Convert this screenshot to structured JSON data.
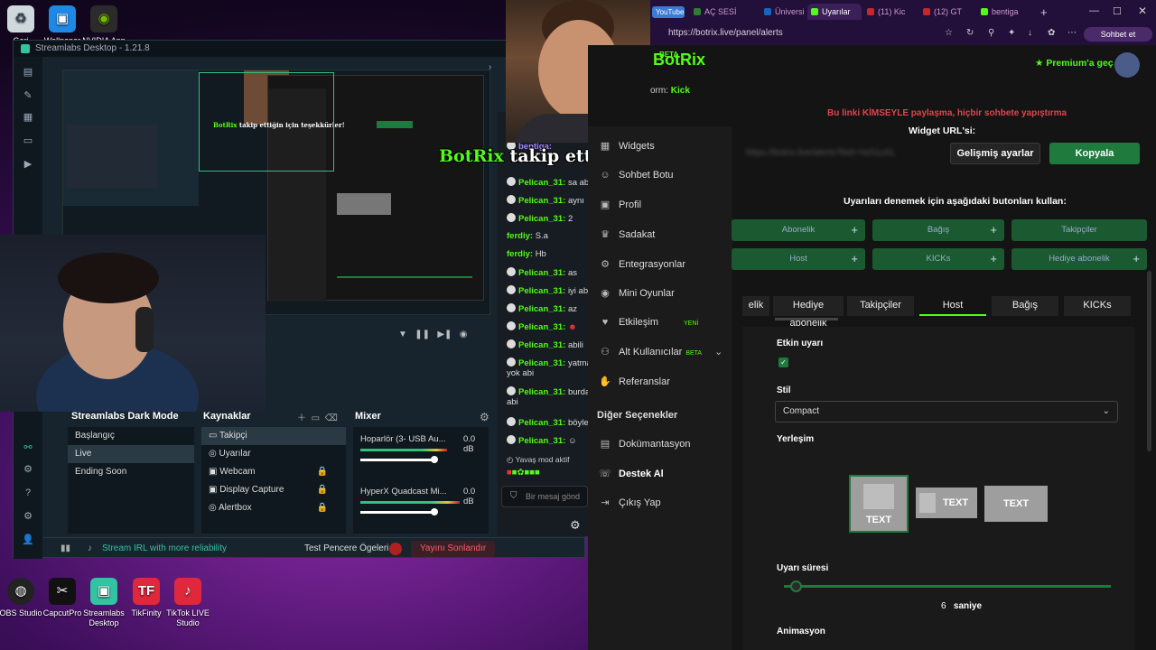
{
  "desktop": {
    "top_icons": [
      {
        "label": "Geri",
        "icon": "recycle-bin-icon"
      },
      {
        "label": "Wallpaper",
        "icon": "wallpaper-icon"
      },
      {
        "label": "NVIDIA App",
        "icon": "nvidia-icon"
      }
    ],
    "bottom_icons": [
      {
        "label": "OBS Studio",
        "icon": "obs-icon"
      },
      {
        "label": "CapcutPro",
        "icon": "capcut-icon"
      },
      {
        "label": "Streamlabs Desktop",
        "icon": "streamlabs-icon"
      },
      {
        "label": "TikFinity",
        "icon": "tikfinity-icon"
      },
      {
        "label": "TikTok LIVE Studio",
        "icon": "tiktok-live-icon"
      }
    ]
  },
  "streamlabs": {
    "title": "Streamlabs Desktop - 1.21.8",
    "scenes_title": "Streamlabs Dark Mode",
    "scenes": [
      "Başlangıç",
      "Live",
      "Ending Soon"
    ],
    "active_scene": "Live",
    "sources_title": "Kaynaklar",
    "sources": [
      "Takipçi",
      "Uyarılar",
      "Webcam",
      "Display Capture",
      "Alertbox"
    ],
    "mixer_title": "Mixer",
    "mixer": [
      {
        "name": "Hoparlör (3- USB Au...",
        "db": "0.0 dB"
      },
      {
        "name": "HyperX Quadcast Mi...",
        "db": "0.0 dB"
      }
    ],
    "footer": {
      "promo": "Stream IRL with more reliability",
      "test": "Test Pencere Ögeleri",
      "end_stream": "Yayını Sonlandır"
    }
  },
  "chat": {
    "messages": [
      {
        "user": "Pelican_31:",
        "text": "sa ab"
      },
      {
        "user": "Pelican_31:",
        "text": "aynı"
      },
      {
        "user": "Pelican_31:",
        "text": "2"
      },
      {
        "user": "ferdiy:",
        "text": "S.a"
      },
      {
        "user": "ferdiy:",
        "text": "Hb"
      },
      {
        "user": "Pelican_31:",
        "text": "as"
      },
      {
        "user": "Pelican_31:",
        "text": "iyi ab"
      },
      {
        "user": "Pelican_31:",
        "text": "az"
      },
      {
        "user": "Pelican_31:",
        "text": ""
      },
      {
        "user": "Pelican_31:",
        "text": "abili"
      },
      {
        "user": "Pelican_31:",
        "text": "yatma"
      },
      {
        "user": "",
        "text": "yok abi"
      },
      {
        "user": "Pelican_31:",
        "text": "burda"
      },
      {
        "user": "",
        "text": "abi"
      },
      {
        "user": "Pelican_31:",
        "text": "böyle"
      },
      {
        "user": "Pelican_31:",
        "text": ""
      }
    ],
    "first_user": "bentiga:",
    "slow_mode": "Yavaş mod aktif",
    "input_placeholder": "Bir mesaj gönd"
  },
  "overlay": {
    "brand": "BotRix",
    "text": " takip ettiğin için teşekkürler!"
  },
  "browser": {
    "tabs": [
      {
        "label": "YouTube",
        "color": "#d32f2f"
      },
      {
        "label": "AÇ SESİ",
        "color": "#2e7d32"
      },
      {
        "label": "Üniversi",
        "color": "#1565c0"
      },
      {
        "label": "Uyarılar",
        "color": "#53fc18"
      },
      {
        "label": "(11) Kic",
        "color": "#c62828"
      },
      {
        "label": "(12) GT",
        "color": "#c62828"
      },
      {
        "label": "bentiga",
        "color": "#53fc18"
      }
    ],
    "url": "https://botrix.live/panel/alerts",
    "profile_button": "Sohbet et"
  },
  "botrix": {
    "logo": "BotRix",
    "beta": "BETA",
    "premium": "Premium'a geç",
    "platform_label": "orm:",
    "platform": "Kick",
    "nav": [
      {
        "label": "Widgets",
        "icon": "widgets-icon"
      },
      {
        "label": "Sohbet Botu",
        "icon": "bot-icon"
      },
      {
        "label": "Profil",
        "icon": "profile-icon"
      },
      {
        "label": "Sadakat",
        "icon": "trophy-icon"
      },
      {
        "label": "Entegrasyonlar",
        "icon": "integrations-icon"
      },
      {
        "label": "Mini Oyunlar",
        "icon": "gamepad-icon"
      },
      {
        "label": "Etkileşim",
        "icon": "heart-icon",
        "badge": "YENİ"
      },
      {
        "label": "Alt Kullanıcılar",
        "icon": "users-icon",
        "badge": "BETA"
      },
      {
        "label": "Referanslar",
        "icon": "handshake-icon"
      }
    ],
    "other_section": "Diğer Seçenekler",
    "other_nav": [
      {
        "label": "Dokümantasyon",
        "icon": "doc-icon"
      },
      {
        "label": "Destek Al",
        "icon": "support-icon"
      },
      {
        "label": "Çıkış Yap",
        "icon": "logout-icon"
      }
    ],
    "warning": "Bu linki KİMSEYLE paylaşma, hiçbir sohbete yapıştırma",
    "widget_url_label": "Widget URL'si:",
    "widget_url": "https://botrix.live/alerts?bid=YaS1uSL",
    "advanced_button": "Gelişmiş ayarlar",
    "copy_button": "Kopyala",
    "test_hint": "Uyarıları denemek için aşağıdaki butonları kullan:",
    "test_buttons": [
      "Abonelik",
      "Bağış",
      "Takipçiler",
      "Host",
      "KICKs",
      "Hediye abonelik"
    ],
    "alert_tabs": [
      "elik",
      "Hediye abonelik",
      "Takipçiler",
      "Host",
      "Bağış",
      "KICKs"
    ],
    "active_tab": "Host",
    "enabled_label": "Etkin uyarı",
    "style_label": "Stil",
    "style_value": "Compact",
    "layout_label": "Yerleşim",
    "layout_text": "TEXT",
    "duration_label": "Uyarı süresi",
    "duration_value": "6",
    "duration_unit": "saniye",
    "animation_label": "Animasyon"
  },
  "colors": {
    "kick_green": "#53fc18",
    "button_green": "#1f7a3d",
    "warning_red": "#e0444c"
  }
}
